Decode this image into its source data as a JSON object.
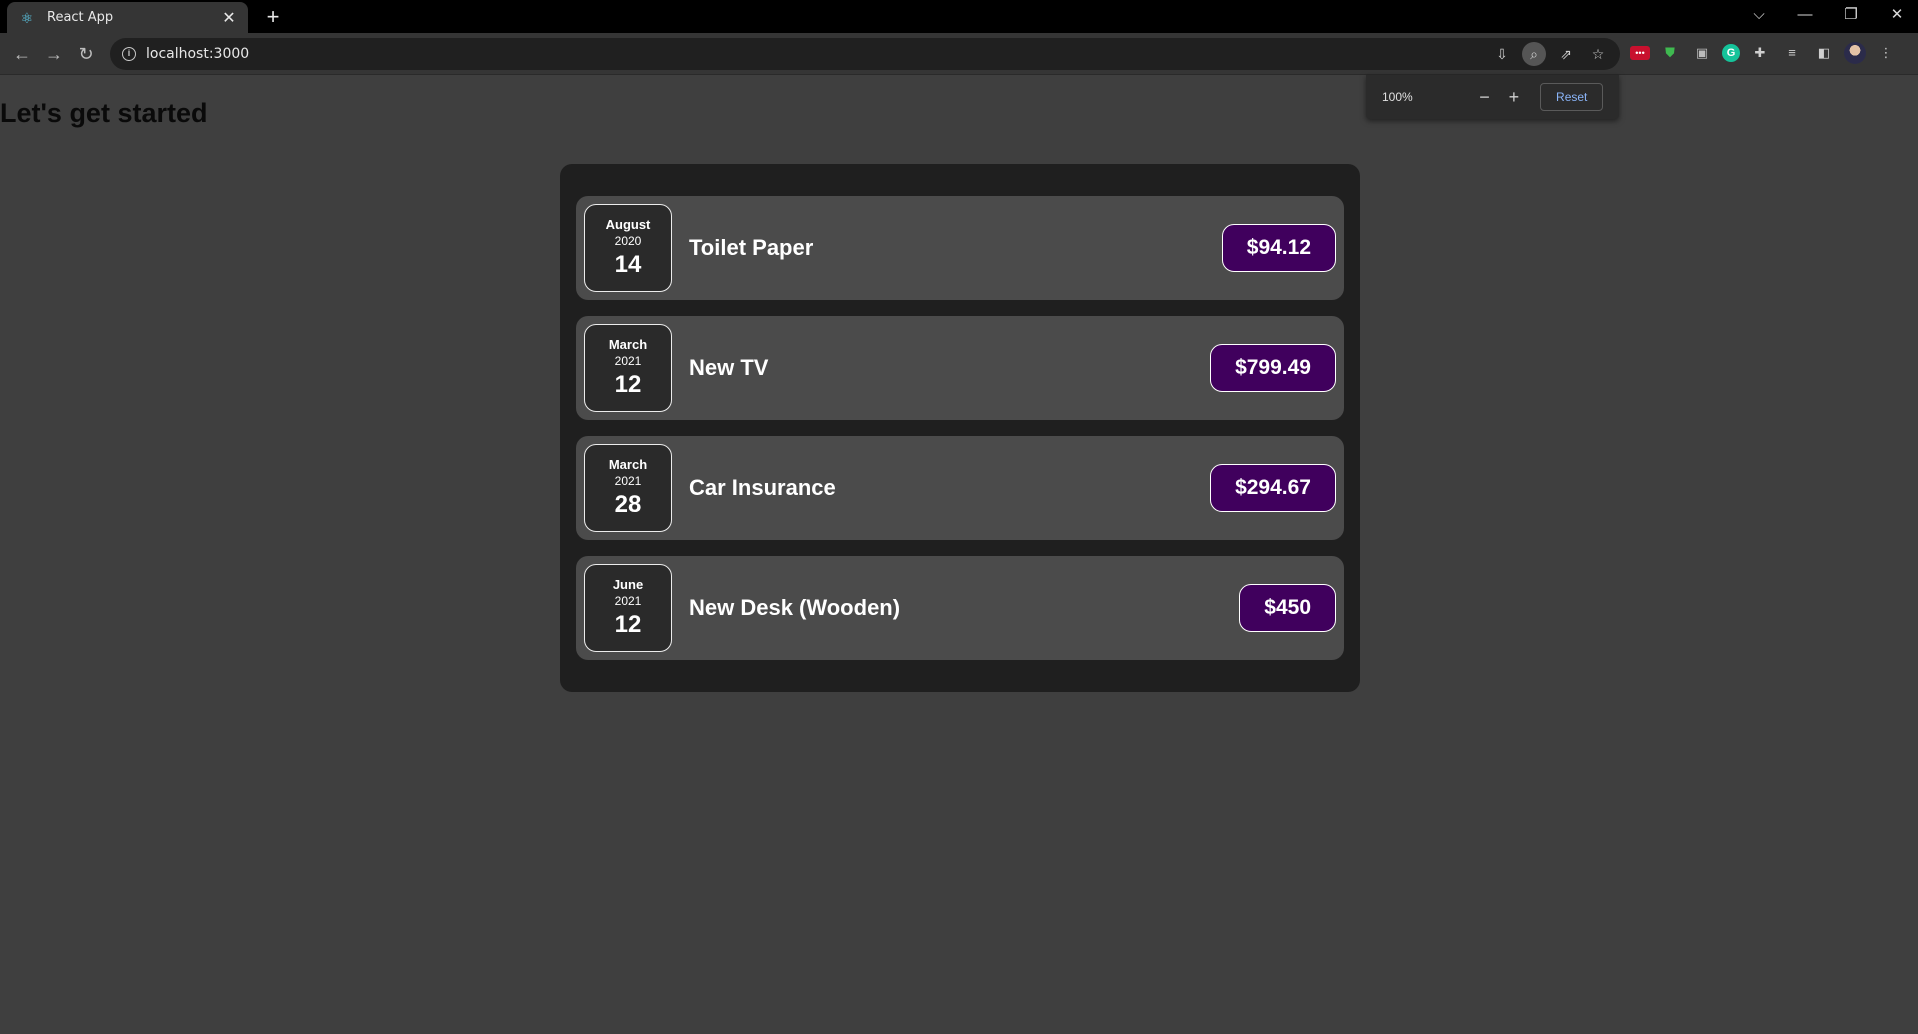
{
  "browser": {
    "tab_title": "React App",
    "tab_close": "✕",
    "new_tab": "+",
    "url": "localhost:3000",
    "zoom": {
      "percent": "100%",
      "minus": "−",
      "plus": "+",
      "reset_label": "Reset"
    },
    "window": {
      "chevron": "⌵",
      "minimize": "—",
      "restore": "❐",
      "close": "✕"
    }
  },
  "page": {
    "heading": "Let's get started",
    "expenses": [
      {
        "month": "August",
        "year": "2020",
        "day": "14",
        "title": "Toilet Paper",
        "amount": "$94.12"
      },
      {
        "month": "March",
        "year": "2021",
        "day": "12",
        "title": "New TV",
        "amount": "$799.49"
      },
      {
        "month": "March",
        "year": "2021",
        "day": "28",
        "title": "Car Insurance",
        "amount": "$294.67"
      },
      {
        "month": "June",
        "year": "2021",
        "day": "12",
        "title": "New Desk (Wooden)",
        "amount": "$450"
      }
    ]
  },
  "colors": {
    "page_background": "#3f3f3f",
    "card_background": "#1f1f1f",
    "item_background": "#4b4b4b",
    "price_background": "#40005d"
  }
}
